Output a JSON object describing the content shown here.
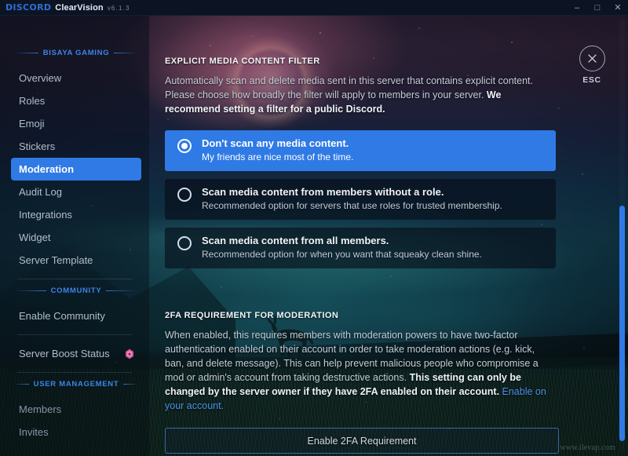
{
  "titlebar": {
    "brand": "DISCORD",
    "theme": "ClearVision",
    "version": "v6.1.3",
    "minimize": "–",
    "maximize": "□",
    "close": "✕"
  },
  "sidebar": {
    "server_header": "BISAYA GAMING",
    "community_header": "COMMUNITY",
    "user_management_header": "USER MANAGEMENT",
    "server_items": [
      {
        "label": "Overview",
        "active": false
      },
      {
        "label": "Roles",
        "active": false
      },
      {
        "label": "Emoji",
        "active": false
      },
      {
        "label": "Stickers",
        "active": false
      },
      {
        "label": "Moderation",
        "active": true
      },
      {
        "label": "Audit Log",
        "active": false
      },
      {
        "label": "Integrations",
        "active": false
      },
      {
        "label": "Widget",
        "active": false
      },
      {
        "label": "Server Template",
        "active": false
      }
    ],
    "community_items": [
      {
        "label": "Enable Community"
      }
    ],
    "boost_item": {
      "label": "Server Boost Status"
    },
    "user_items": [
      {
        "label": "Members"
      },
      {
        "label": "Invites"
      }
    ]
  },
  "main": {
    "filter_section": {
      "title": "EXPLICIT MEDIA CONTENT FILTER",
      "desc_part1": "Automatically scan and delete media sent in this server that contains explicit content. Please choose how broadly the filter will apply to members in your server. ",
      "desc_bold": "We recommend setting a filter for a public Discord.",
      "options": [
        {
          "title": "Don't scan any media content.",
          "subtitle": "My friends are nice most of the time.",
          "selected": true
        },
        {
          "title": "Scan media content from members without a role.",
          "subtitle": "Recommended option for servers that use roles for trusted membership.",
          "selected": false
        },
        {
          "title": "Scan media content from all members.",
          "subtitle": "Recommended option for when you want that squeaky clean shine.",
          "selected": false
        }
      ]
    },
    "twofa_section": {
      "title": "2FA REQUIREMENT FOR MODERATION",
      "desc_part1": "When enabled, this requires members with moderation powers to have two-factor authentication enabled on their account in order to take moderation actions (e.g. kick, ban, and delete message). This can help prevent malicious people who compromise a mod or admin's account from taking destructive actions. ",
      "desc_bold": "This setting can only be changed by the server owner if they have 2FA enabled on their account.",
      "desc_link": " Enable on your account.",
      "button_label": "Enable 2FA Requirement"
    }
  },
  "esc": {
    "label": "ESC",
    "glyph": "✕"
  },
  "watermark": "www.ilevap.com",
  "colors": {
    "accent_blue": "#2f7ae5",
    "header_blue": "#3d84e8",
    "link_blue": "#4a90e8",
    "boost_pink": "#e0569c",
    "panel_dark": "rgba(6,12,22,0.62)"
  }
}
